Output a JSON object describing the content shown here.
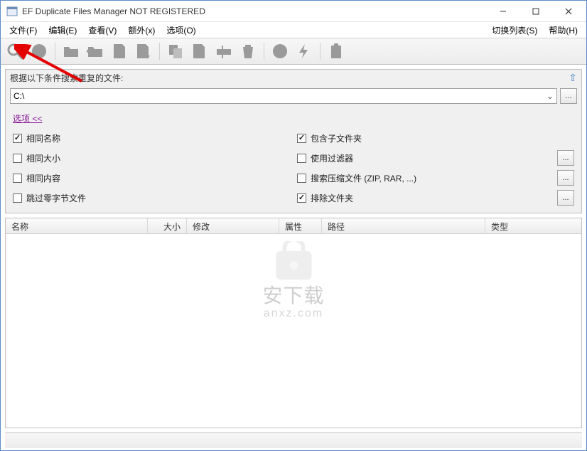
{
  "window": {
    "title": "EF Duplicate Files Manager NOT REGISTERED"
  },
  "menu": {
    "file": "文件(F)",
    "edit": "编辑(E)",
    "view": "查看(V)",
    "extra": "额外(x)",
    "options": "选项(O)",
    "switch_list": "切换列表(S)",
    "help": "帮助(H)"
  },
  "panel": {
    "header": "根据以下条件搜索重复的文件:",
    "path_value": "C:\\",
    "options_link": "选项  <<"
  },
  "checks": {
    "same_name": "相同名称",
    "same_size": "相同大小",
    "same_content": "相同内容",
    "skip_zero_byte": "跳过零字节文件",
    "include_subfolders": "包含子文件夹",
    "use_filters": "使用过滤器",
    "search_archives": "搜索压缩文件 (ZIP, RAR, ...)",
    "exclude_folders": "排除文件夹"
  },
  "columns": {
    "name": "名称",
    "size": "大小",
    "modified": "修改",
    "attributes": "属性",
    "path": "路径",
    "type": "类型"
  },
  "watermark": {
    "main": "安下载",
    "sub": "anxz.com"
  },
  "ellipsis": "..."
}
